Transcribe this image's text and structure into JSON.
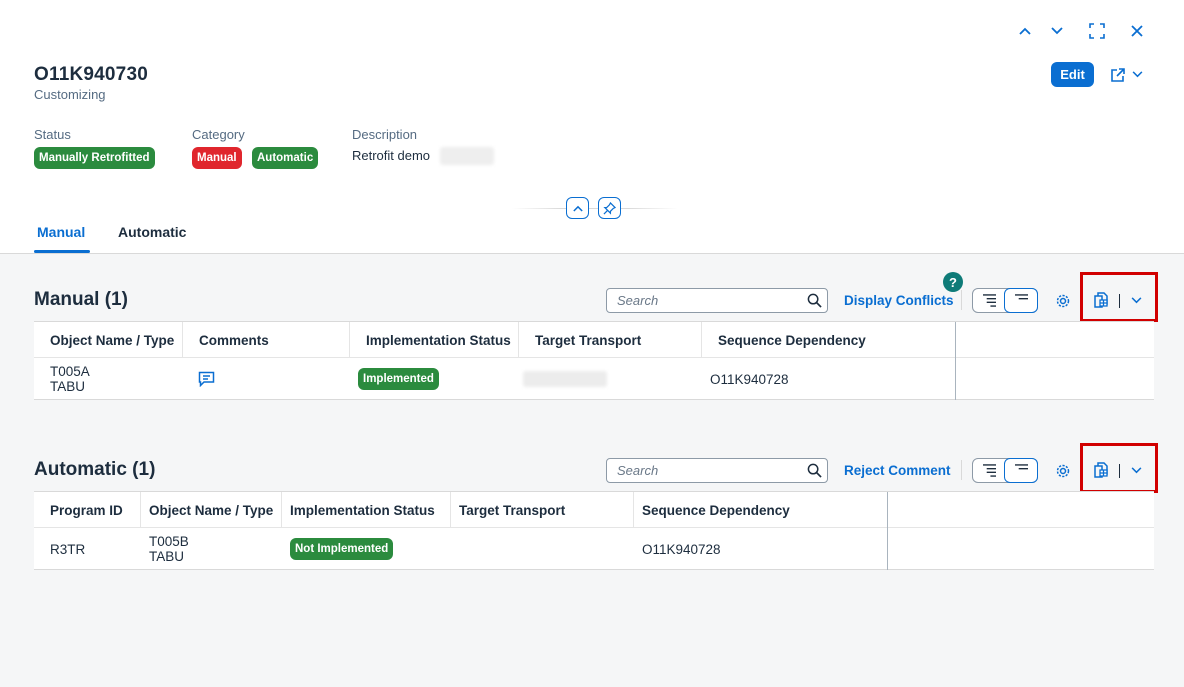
{
  "object_header": {
    "title": "O11K940730",
    "subtitle": "Customizing",
    "edit_label": "Edit",
    "attributes": {
      "status_label": "Status",
      "status_value": "Manually Retrofitted",
      "category_label": "Category",
      "category_values": [
        "Manual",
        "Automatic"
      ],
      "description_label": "Description",
      "description_value": "Retrofit demo"
    }
  },
  "tabs": [
    {
      "label": "Manual",
      "active": true
    },
    {
      "label": "Automatic",
      "active": false
    }
  ],
  "manual_section": {
    "title": "Manual (1)",
    "search_placeholder": "Search",
    "action_label": "Display Conflicts",
    "help_glyph": "?",
    "columns": [
      "Object Name / Type",
      "Comments",
      "Implementation Status",
      "Target Transport",
      "Sequence Dependency"
    ],
    "rows": [
      {
        "object_name": "T005A",
        "object_type": "TABU",
        "comments_icon": "comment-icon",
        "status": "Implemented",
        "target_transport": "",
        "sequence_dependency": "O11K940728"
      }
    ]
  },
  "automatic_section": {
    "title": "Automatic (1)",
    "search_placeholder": "Search",
    "action_label": "Reject Comment",
    "columns": [
      "Program ID",
      "Object Name / Type",
      "Implementation Status",
      "Target Transport",
      "Sequence Dependency"
    ],
    "rows": [
      {
        "program_id": "R3TR",
        "object_name": "T005B",
        "object_type": "TABU",
        "status": "Not Implemented",
        "target_transport": "",
        "sequence_dependency": "O11K940728"
      }
    ]
  },
  "colors": {
    "brand_blue": "#0a6ed1",
    "positive_green": "#2b8b3e",
    "negative_red": "#e0262d",
    "highlight_red": "#d10000"
  }
}
